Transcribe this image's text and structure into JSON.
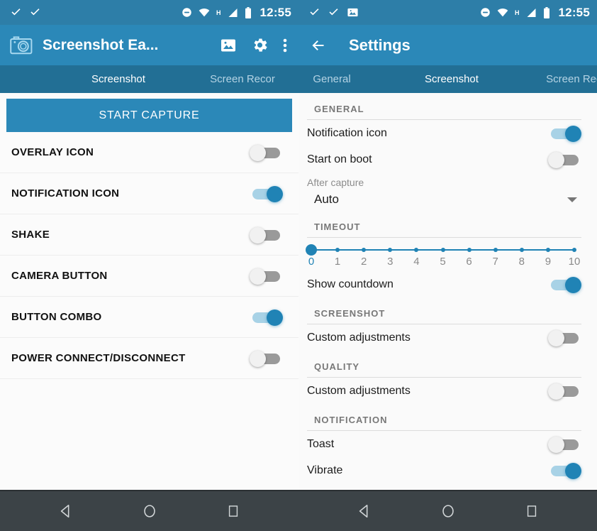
{
  "status_bar": {
    "time": "12:55",
    "left_icons_pane1": [
      "checkmark-icon",
      "checkmark-icon"
    ],
    "left_icons_pane2": [
      "checkmark-icon",
      "checkmark-icon",
      "image-icon"
    ],
    "right_icons": [
      "do-not-disturb-icon",
      "wifi-icon",
      "H",
      "signal-icon",
      "battery-icon"
    ],
    "network_type": "H"
  },
  "left_pane": {
    "app_bar": {
      "title": "Screenshot Ea...",
      "icons": [
        "camera-icon",
        "gallery-icon",
        "gear-icon",
        "overflow-menu-icon"
      ]
    },
    "tabs": [
      {
        "label": "Screenshot",
        "active": true
      },
      {
        "label": "Screen Recor",
        "active": false
      }
    ],
    "start_capture_label": "START CAPTURE",
    "rows": [
      {
        "label": "OVERLAY ICON",
        "state": "off"
      },
      {
        "label": "NOTIFICATION ICON",
        "state": "on"
      },
      {
        "label": "SHAKE",
        "state": "off"
      },
      {
        "label": "CAMERA BUTTON",
        "state": "off"
      },
      {
        "label": "BUTTON COMBO",
        "state": "on"
      },
      {
        "label": "POWER CONNECT/DISCONNECT",
        "state": "off"
      }
    ]
  },
  "right_pane": {
    "app_bar": {
      "back_icon": "arrow-back-icon",
      "title": "Settings"
    },
    "tabs": [
      {
        "label": "General",
        "active": false
      },
      {
        "label": "Screenshot",
        "active": true
      },
      {
        "label": "Screen Recor",
        "active": false
      }
    ],
    "sections": {
      "general": {
        "heading": "GENERAL",
        "notification_icon": {
          "label": "Notification icon",
          "state": "on"
        },
        "start_on_boot": {
          "label": "Start on boot",
          "state": "off"
        },
        "after_capture": {
          "label": "After capture",
          "value": "Auto"
        }
      },
      "timeout": {
        "heading": "TIMEOUT",
        "ticks": [
          "0",
          "1",
          "2",
          "3",
          "4",
          "5",
          "6",
          "7",
          "8",
          "9",
          "10"
        ],
        "value": 0,
        "min": 0,
        "max": 10,
        "show_countdown": {
          "label": "Show countdown",
          "state": "on"
        }
      },
      "screenshot": {
        "heading": "SCREENSHOT",
        "custom_adjustments": {
          "label": "Custom adjustments",
          "state": "off"
        }
      },
      "quality": {
        "heading": "QUALITY",
        "custom_adjustments": {
          "label": "Custom adjustments",
          "state": "off"
        }
      },
      "notification": {
        "heading": "NOTIFICATION",
        "toast": {
          "label": "Toast",
          "state": "off"
        },
        "vibrate": {
          "label": "Vibrate",
          "state": "on"
        }
      }
    }
  },
  "nav_bar": {
    "buttons": [
      "back-nav-icon",
      "home-nav-icon",
      "recents-nav-icon"
    ]
  },
  "colors": {
    "status_bar": "#2d7ea8",
    "app_bar": "#2b88b8",
    "tab_bar": "#226f95",
    "accent": "#2083b5",
    "nav_bar": "#3c4347"
  }
}
